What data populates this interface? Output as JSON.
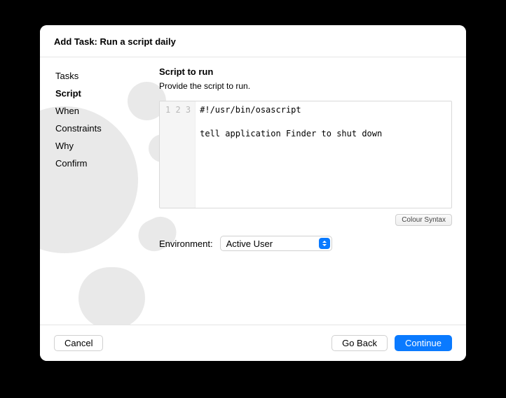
{
  "header": {
    "title": "Add Task: Run a script daily"
  },
  "sidebar": {
    "items": [
      {
        "label": "Tasks",
        "active": false
      },
      {
        "label": "Script",
        "active": true
      },
      {
        "label": "When",
        "active": false
      },
      {
        "label": "Constraints",
        "active": false
      },
      {
        "label": "Why",
        "active": false
      },
      {
        "label": "Confirm",
        "active": false
      }
    ]
  },
  "main": {
    "section_title": "Script to run",
    "section_desc": "Provide the script to run.",
    "code_lines": [
      "#!/usr/bin/osascript",
      "",
      "tell application Finder to shut down"
    ],
    "color_syntax_label": "Colour Syntax",
    "environment_label": "Environment:",
    "environment_value": "Active User"
  },
  "footer": {
    "cancel": "Cancel",
    "go_back": "Go Back",
    "continue": "Continue"
  }
}
